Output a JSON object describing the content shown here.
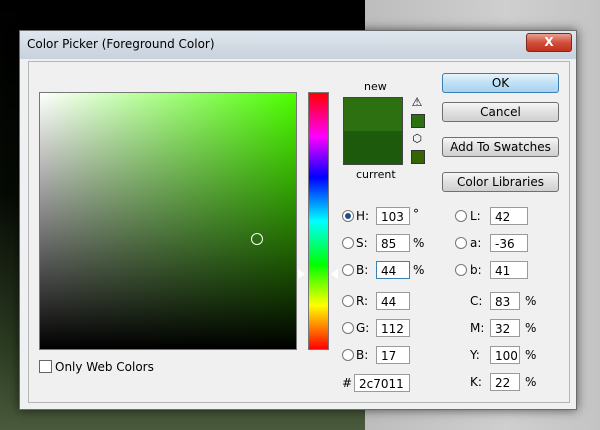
{
  "window": {
    "title": "Color Picker (Foreground Color)",
    "close_label": "X"
  },
  "color": {
    "new": "#2c7011",
    "current": "#1e5a0c",
    "gamut_swatch": "#2c7011",
    "websafe_swatch": "#336600"
  },
  "preview": {
    "new_label": "new",
    "current_label": "current"
  },
  "options": {
    "only_web_colors": "Only Web Colors"
  },
  "buttons": {
    "ok": "OK",
    "cancel": "Cancel",
    "add_to_swatches": "Add To Swatches",
    "color_libraries": "Color Libraries"
  },
  "hsb": {
    "h": {
      "label": "H:",
      "value": "103",
      "unit": "°"
    },
    "s": {
      "label": "S:",
      "value": "85",
      "unit": "%"
    },
    "b": {
      "label": "B:",
      "value": "44",
      "unit": "%"
    }
  },
  "rgb": {
    "r": {
      "label": "R:",
      "value": "44"
    },
    "g": {
      "label": "G:",
      "value": "112"
    },
    "b": {
      "label": "B:",
      "value": "17"
    }
  },
  "lab": {
    "l": {
      "label": "L:",
      "value": "42"
    },
    "a": {
      "label": "a:",
      "value": "-36"
    },
    "b": {
      "label": "b:",
      "value": "41"
    }
  },
  "cmyk": {
    "c": {
      "label": "C:",
      "value": "83",
      "unit": "%"
    },
    "m": {
      "label": "M:",
      "value": "32",
      "unit": "%"
    },
    "y": {
      "label": "Y:",
      "value": "100",
      "unit": "%"
    },
    "k": {
      "label": "K:",
      "value": "22",
      "unit": "%"
    }
  },
  "hex": {
    "label": "#",
    "value": "2c7011"
  }
}
